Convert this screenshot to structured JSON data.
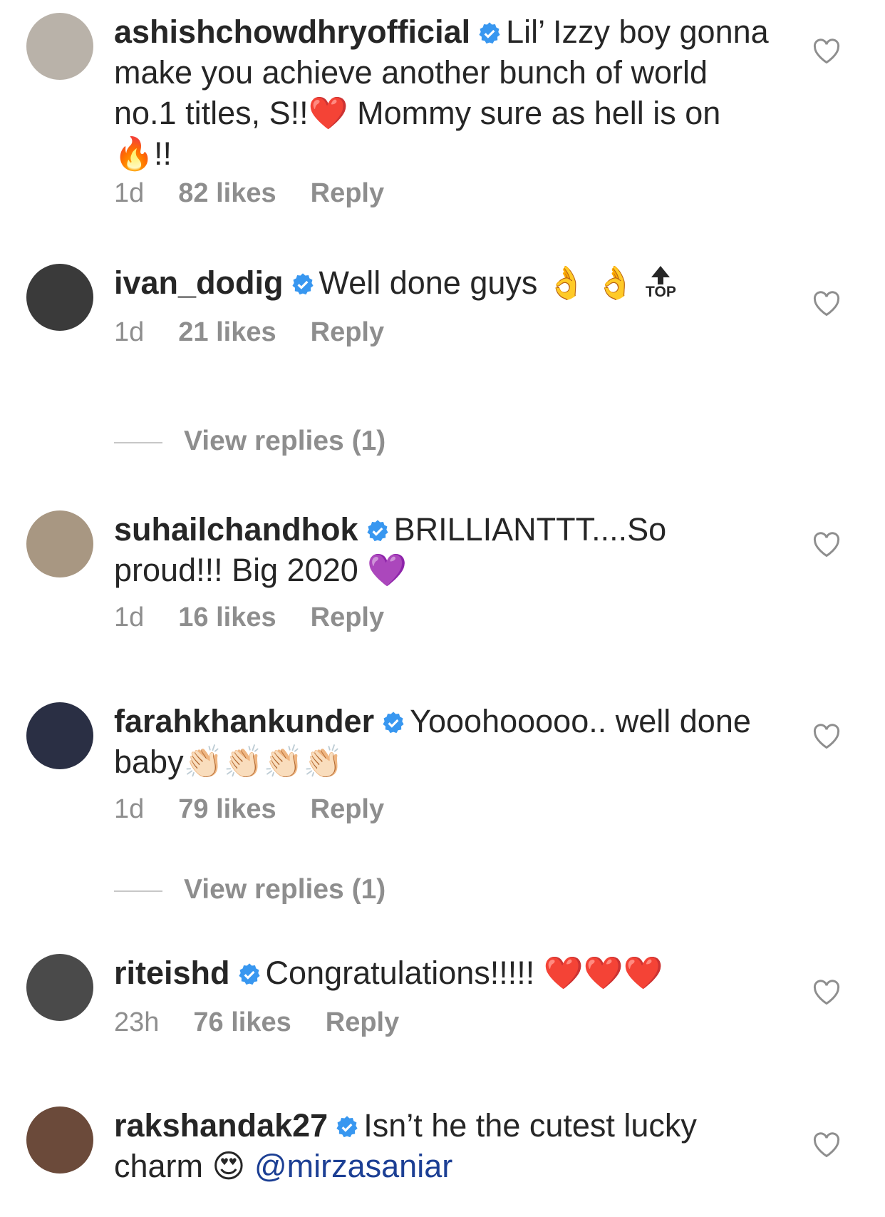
{
  "comments": [
    {
      "username": "ashishchowdhryofficial",
      "text": "Lil’ Izzy boy gonna make you achieve another bunch of world no.1 titles, S!!❤️ Mommy sure as hell is on 🔥!!",
      "time": "1d",
      "likes": "82 likes",
      "reply": "Reply",
      "avatar_color": "#b9b2a9"
    },
    {
      "username": "ivan_dodig",
      "text": "Well done guys 👌 👌",
      "top_badge": "TOP",
      "time": "1d",
      "likes": "21 likes",
      "reply": "Reply",
      "view_replies": "View replies (1)",
      "avatar_color": "#3a3a3a"
    },
    {
      "username": "suhailchandhok",
      "text": "BRILLIANTTT....So proud!!! Big 2020 💜",
      "time": "1d",
      "likes": "16 likes",
      "reply": "Reply",
      "avatar_color": "#a89782"
    },
    {
      "username": "farahkhankunder",
      "text": "Yooohooooo.. well done baby👏🏻👏🏻👏🏻👏🏻",
      "time": "1d",
      "likes": "79 likes",
      "reply": "Reply",
      "view_replies": "View replies (1)",
      "avatar_color": "#2a2f44"
    },
    {
      "username": "riteishd",
      "text": "Congratulations!!!!! ❤️❤️❤️",
      "time": "23h",
      "likes": "76 likes",
      "reply": "Reply",
      "avatar_color": "#4a4a4a"
    },
    {
      "username": "rakshandak27",
      "text": "Isn’t he the cutest lucky charm 😍",
      "mention": "@mirzasaniar",
      "avatar_color": "#6b4a3a"
    }
  ],
  "colors": {
    "verified_badge": "#3897f0",
    "secondary_text": "#8e8e8e",
    "mention": "#1c3f94"
  },
  "icons": {
    "like": "heart-outline-icon",
    "verified": "verified-badge-icon",
    "top": "top-arrow-icon"
  }
}
